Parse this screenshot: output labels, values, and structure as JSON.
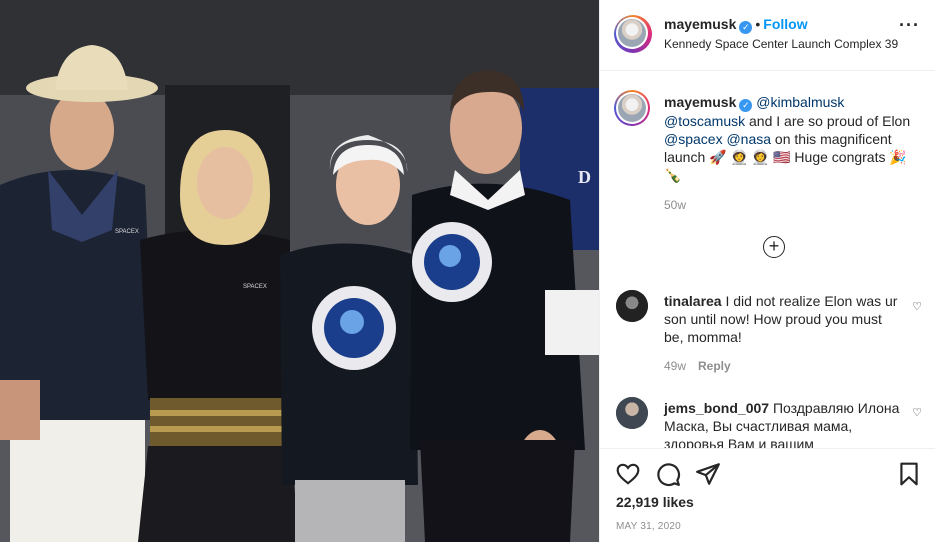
{
  "post": {
    "username": "mayemusk",
    "follow_label": "Follow",
    "location": "Kennedy Space Center Launch Complex 39",
    "caption": {
      "mention1": "@kimbalmusk",
      "mention2": "@toscamusk",
      "text1": " and I are so proud of Elon ",
      "mention3": "@spacex",
      "mention4": "@nasa",
      "text2": " on this magnificent launch 🚀 👩‍🚀 👩‍🚀 🇺🇸 Huge congrats 🎉 🍾"
    },
    "age": "50w",
    "likes": "22,919 likes",
    "date": "MAY 31, 2020"
  },
  "comments": [
    {
      "username": "tinalarea",
      "text": "I did not realize Elon was ur son until now! How proud you must be, momma!",
      "age": "49w",
      "reply_label": "Reply"
    },
    {
      "username": "jems_bond_007",
      "text": "Поздравляю Илона Маска, Вы счастливая мама, здоровья Вам и вашим",
      "age": "",
      "reply_label": ""
    }
  ],
  "photo_text": {
    "spacex_logo": "SPACEX",
    "backdrop_letter": "D"
  },
  "colors": {
    "accent": "#0095f6",
    "verified": "#3897f0",
    "muted": "#8e8e8e"
  },
  "icons": [
    "verified-icon",
    "more-icon",
    "heart-icon",
    "comment-icon",
    "share-icon",
    "bookmark-icon",
    "plus-circle-icon"
  ]
}
